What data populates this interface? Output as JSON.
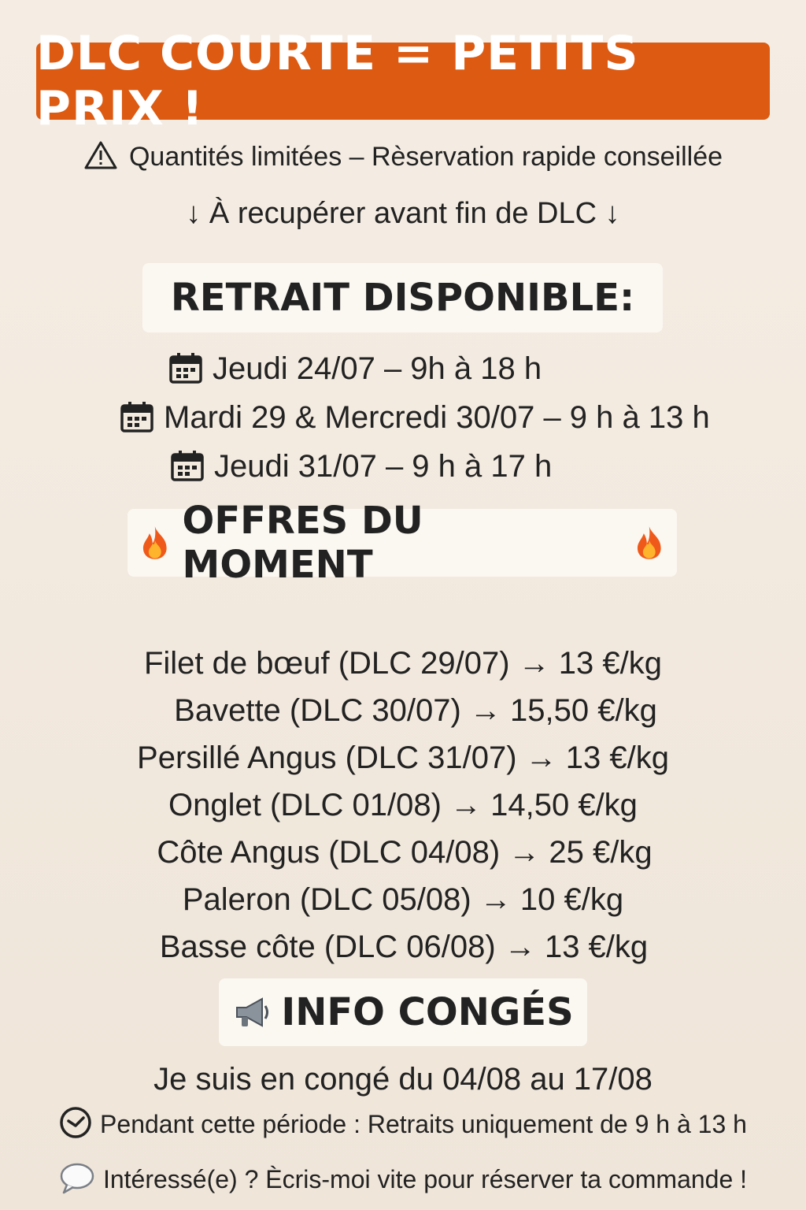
{
  "banner": {
    "title": "DLC COURTE = PETITS PRIX !"
  },
  "notice": {
    "warning": "Quantités limitées – Rèservation rapide conseillée",
    "pickup": "↓ À recupérer avant fin de DLC ↓"
  },
  "retrait": {
    "heading": "RETRAIT DISPONIBLE:",
    "slots": [
      "Jeudi 24/07 – 9h à 18 h",
      "Mardi 29 & Mercredi 30/07 – 9 h à 13 h",
      "Jeudi 31/07 – 9 h à 17 h"
    ]
  },
  "offres": {
    "heading": "OFFRES DU MOMENT",
    "items": [
      "Filet de bœuf (DLC 29/07) → 13 €/kg",
      "Bavette (DLC 30/07) → 15,50 €/kg",
      "Persillé Angus (DLC 31/07) → 13 €/kg",
      "Onglet (DLC 01/08) → 14,50 €/kg",
      "Côte Angus (DLC 04/08) → 25 €/kg",
      "Paleron (DLC 05/08) → 10 €/kg",
      "Basse côte (DLC 06/08) → 13 €/kg"
    ]
  },
  "info": {
    "heading": "INFO CONGÉS",
    "conge": "Je suis en congé du 04/08 au 17/08",
    "periode": "Pendant cette période : Retraits uniquement de 9 h à 13 h",
    "contact": "Intéressé(e) ? Ècris-moi vite pour réserver ta commande !"
  },
  "icons": {
    "warning": "warning-icon",
    "calendar": "calendar-icon",
    "fire": "fire-icon",
    "megaphone": "megaphone-icon",
    "clock": "clock-icon",
    "speech": "speech-bubble-icon"
  },
  "colors": {
    "banner": "#dd5a12",
    "background": "#f3eae0",
    "pill": "#fbf8f2"
  }
}
